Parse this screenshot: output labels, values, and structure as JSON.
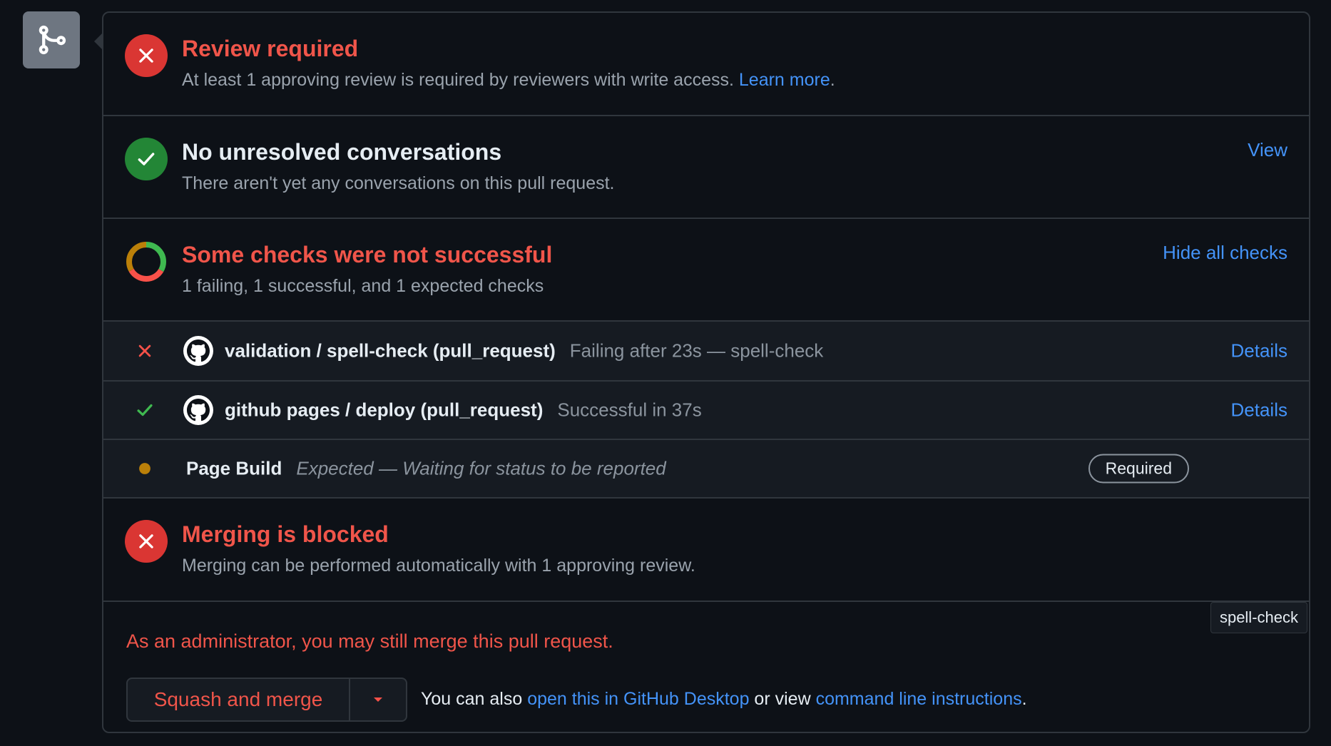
{
  "review": {
    "title": "Review required",
    "desc": "At least 1 approving review is required by reviewers with write access.",
    "link": "Learn more",
    "link_suffix": "."
  },
  "conversations": {
    "title": "No unresolved conversations",
    "desc": "There aren't yet any conversations on this pull request.",
    "action": "View"
  },
  "checks": {
    "title": "Some checks were not successful",
    "desc": "1 failing, 1 successful, and 1 expected checks",
    "action": "Hide all checks",
    "rows": [
      {
        "name": "validation / spell-check (pull_request)",
        "detail": "Failing after 23s — spell-check",
        "link": "Details",
        "status": "failing"
      },
      {
        "name": "github pages / deploy (pull_request)",
        "detail": "Successful in 37s",
        "link": "Details",
        "status": "success"
      },
      {
        "name": "Page Build",
        "detail": "Expected — Waiting for status to be reported",
        "badge": "Required",
        "status": "expected"
      }
    ]
  },
  "blocked": {
    "title": "Merging is blocked",
    "desc": "Merging can be performed automatically with 1 approving review."
  },
  "admin": {
    "note": "As an administrator, you may still merge this pull request.",
    "merge_button": "Squash and merge",
    "alt_prefix": "You can also ",
    "alt_link1": "open this in GitHub Desktop",
    "alt_middle": " or view ",
    "alt_link2": "command line instructions",
    "alt_suffix": ".",
    "tooltip": "spell-check"
  },
  "colors": {
    "danger": "#f0554a",
    "success": "#3fb950",
    "pending": "#bb8009",
    "link": "#4493f8"
  },
  "icons": {
    "sidebar": "git-merge-icon",
    "fail": "x-circle-icon",
    "pass": "check-circle-icon",
    "mixed": "donut-status-icon",
    "avatar": "github-mark-icon",
    "caret": "triangle-down-icon"
  }
}
